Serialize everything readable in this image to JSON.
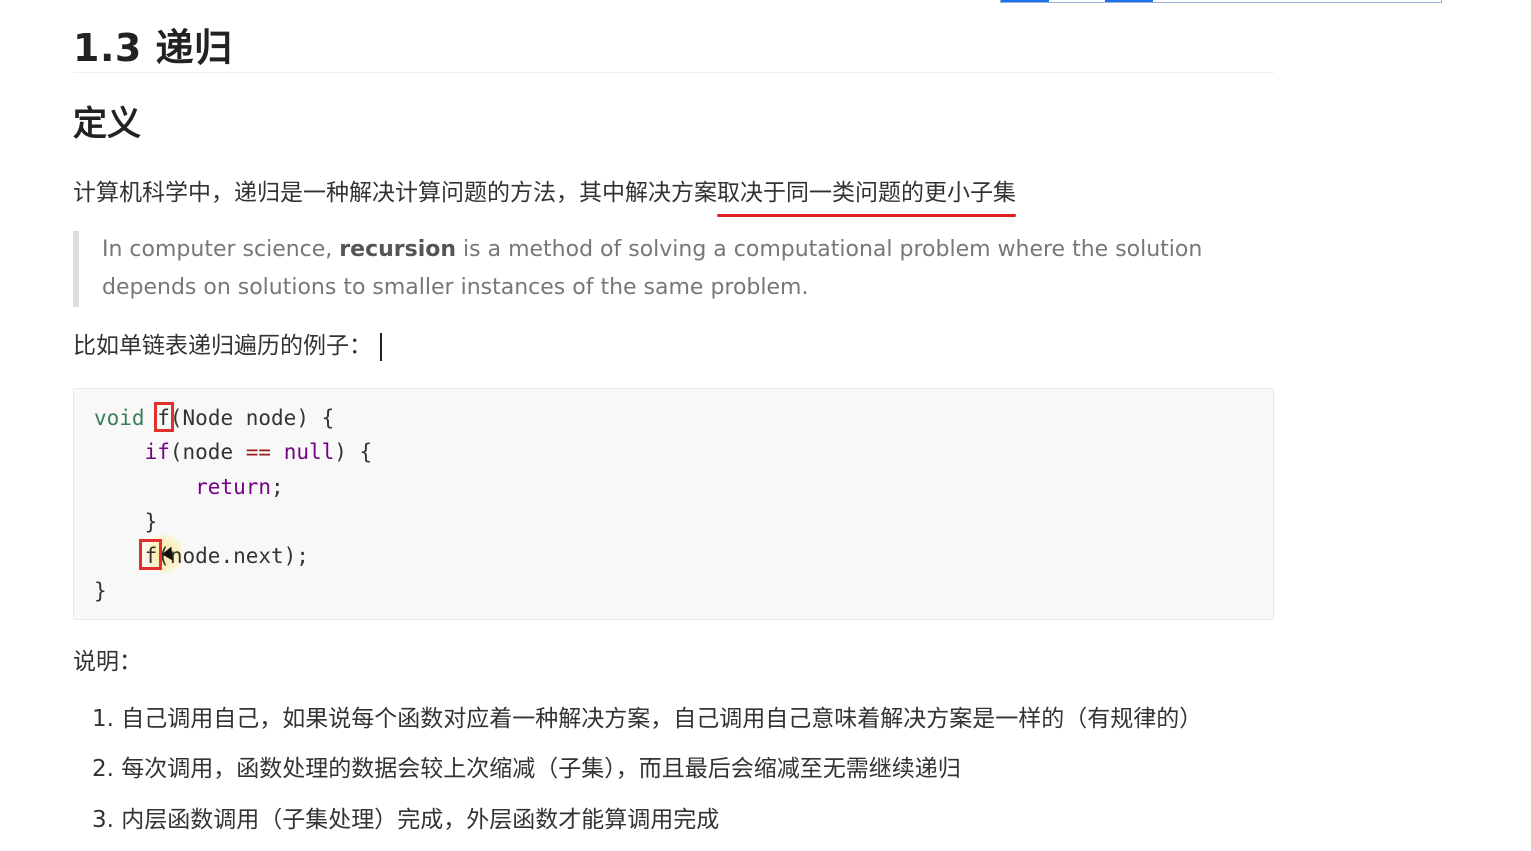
{
  "heading": "1.3 递归",
  "section_title": "定义",
  "definition": {
    "text_before": "计算机科学中，递归是一种解决计算问题的方法，其中解决方案",
    "text_underlined": "取决于同一类问题的更小子集"
  },
  "quote": {
    "before": "In computer science, ",
    "bold": "recursion",
    "after": " is a method of solving a computational problem where the solution depends on solutions to smaller instances of the same problem."
  },
  "example_label": "比如单链表递归遍历的例子：",
  "code": {
    "line1_kw": "void",
    "line1_fn": "f",
    "line1_rest": "(Node node) {",
    "line2_kw": "if",
    "line2_a": "(node ",
    "line2_op": "==",
    "line2_sp": " ",
    "line2_null": "null",
    "line2_rest": ") {",
    "line3_kw": "return",
    "line3_rest": ";",
    "line4": "}",
    "line5_fn": "f",
    "line5_rest": "(node.next);",
    "line6": "}"
  },
  "notes_label": "说明：",
  "notes": [
    "1. 自己调用自己，如果说每个函数对应着一种解决方案，自己调用自己意味着解决方案是一样的（有规律的）",
    "2. 每次调用，函数处理的数据会较上次缩减（子集），而且最后会缩减至无需继续递归",
    "3. 内层函数调用（子集处理）完成，外层函数才能算调用完成"
  ],
  "colors": {
    "highlight_red": "#e03030",
    "keyword_green": "#3a7f5a",
    "keyword_purple": "#770088"
  }
}
